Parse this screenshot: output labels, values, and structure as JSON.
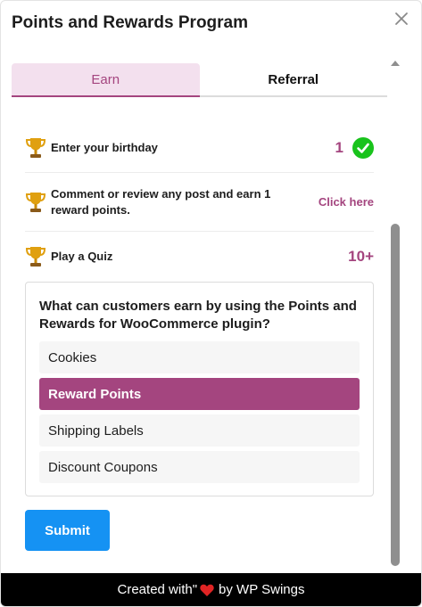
{
  "header": {
    "title": "Points and Rewards Program"
  },
  "tabs": [
    {
      "label": "Earn",
      "active": true
    },
    {
      "label": "Referral",
      "active": false
    }
  ],
  "earn_items": [
    {
      "icon": "trophy-icon",
      "text": "Enter your birthday",
      "points": "1",
      "completed": true
    },
    {
      "icon": "trophy-icon",
      "text": "Comment or review any post and earn 1 reward points.",
      "action_label": "Click here"
    },
    {
      "icon": "trophy-icon",
      "text": "Play a Quiz",
      "points": "10+"
    }
  ],
  "quiz": {
    "question": "What can customers earn by using the Points and Rewards for WooCommerce plugin?",
    "options": [
      {
        "label": "Cookies",
        "selected": false
      },
      {
        "label": "Reward Points",
        "selected": true
      },
      {
        "label": "Shipping Labels",
        "selected": false
      },
      {
        "label": "Discount Coupons",
        "selected": false
      }
    ],
    "submit_label": "Submit"
  },
  "footer": {
    "prefix": "Created with\"",
    "suffix": "by WP Swings"
  },
  "colors": {
    "accent": "#a4457f",
    "tab_active_bg": "#f3e0ee",
    "submit": "#1592f3",
    "check": "#19c31c",
    "heart": "#e02424"
  }
}
